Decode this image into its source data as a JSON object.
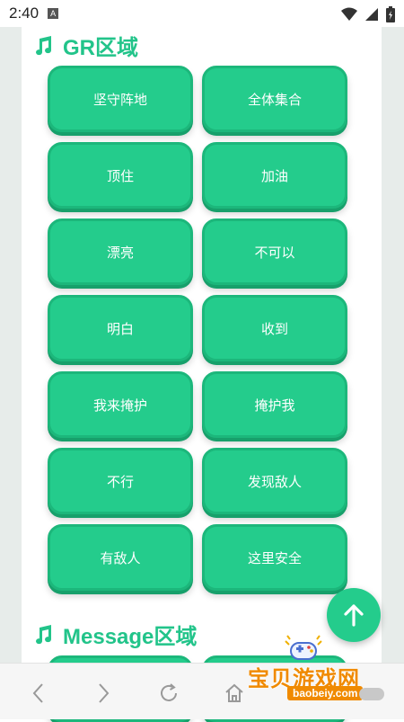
{
  "status": {
    "time": "2:40",
    "notif_letter": "A"
  },
  "sections": [
    {
      "title": "GR区域"
    },
    {
      "title": "Message区域"
    }
  ],
  "buttons": [
    "坚守阵地",
    "全体集合",
    "顶住",
    "加油",
    "漂亮",
    "不可以",
    "明白",
    "收到",
    "我来掩护",
    "掩护我",
    "不行",
    "发现敌人",
    "有敌人",
    "这里安全"
  ],
  "nav": {
    "icons": [
      "back-icon",
      "forward-icon",
      "refresh-icon",
      "home-icon"
    ]
  },
  "watermark": {
    "text": "宝贝游戏网",
    "url": "baobeiy.com"
  },
  "colors": {
    "accent": "#24cc8c",
    "accent_dark": "#17a06b",
    "title": "#22c48a",
    "watermark": "#f08a00"
  }
}
